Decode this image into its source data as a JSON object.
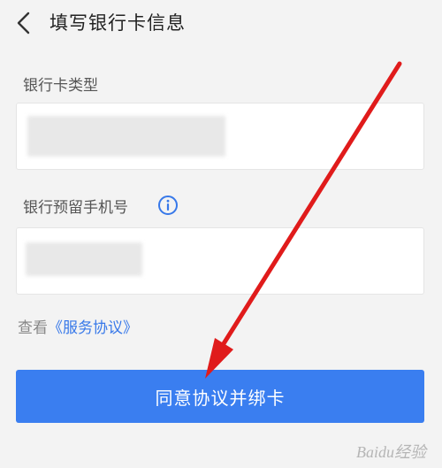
{
  "header": {
    "title": "填写银行卡信息",
    "back_icon": "chevron-left-icon"
  },
  "form": {
    "card_type_label": "银行卡类型",
    "phone_label": "银行预留手机号",
    "info_icon": "info-icon"
  },
  "agreement": {
    "prefix": "查看",
    "link_text": "《服务协议》"
  },
  "primary_button": {
    "label": "同意协议并绑卡",
    "color": "#3a7ef0"
  },
  "annotation": {
    "arrow_color": "#e01b1b"
  },
  "watermark": {
    "text": "Baidu经验"
  }
}
